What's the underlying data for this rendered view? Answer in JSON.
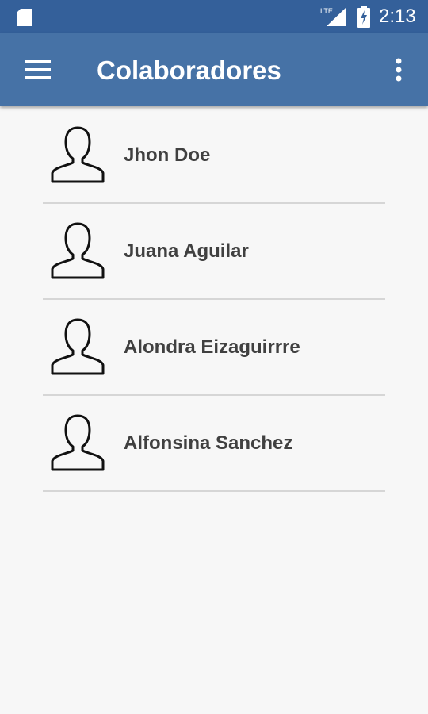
{
  "status_bar": {
    "network": "LTE",
    "time": "2:13",
    "icons": [
      "sd-card-icon",
      "lte-signal-icon",
      "battery-charging-icon"
    ]
  },
  "app_bar": {
    "title": "Colaboradores",
    "menu_icon": "hamburger-menu-icon",
    "overflow_icon": "more-vertical-icon"
  },
  "contacts": [
    {
      "name": "Jhon Doe",
      "icon": "person-outline-icon"
    },
    {
      "name": "Juana Aguilar",
      "icon": "person-outline-icon"
    },
    {
      "name": "Alondra Eizaguirrre",
      "icon": "person-outline-icon"
    },
    {
      "name": "Alfonsina Sanchez",
      "icon": "person-outline-icon"
    }
  ],
  "colors": {
    "status_bar": "#34609a",
    "app_bar": "#4672a6",
    "background": "#f7f7f7",
    "name_text": "#404040",
    "divider": "#d6d6d6"
  }
}
